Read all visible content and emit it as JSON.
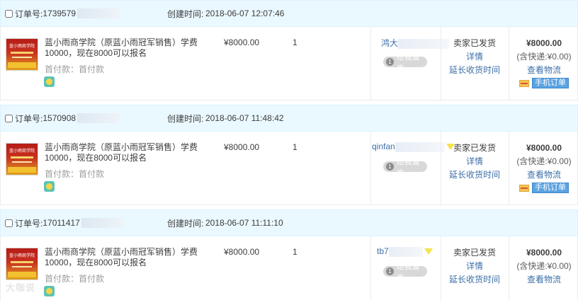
{
  "labels": {
    "order_no": "订单号:",
    "created_at": "创建时间:",
    "first_payment": "首付款：首付款",
    "leave_message": "给我留言",
    "message_count": "1",
    "seller_shipped": "卖家已发货",
    "details": "详情",
    "extend_receipt": "延长收货时间",
    "view_logistics": "查看物流",
    "mobile_order": "手机订单",
    "thumb_title": "蓝小雨商学院"
  },
  "orders": [
    {
      "order_no": "1739579",
      "created_at": "2018-06-07 12:07:46",
      "title": "蓝小雨商学院（原蓝小雨冠军销售）学费10000，现在8000可以报名",
      "price": "¥8000.00",
      "qty": "1",
      "buyer": "鸿大",
      "total": "¥8000.00",
      "shipping": "(含快递:¥0.00)"
    },
    {
      "order_no": "1570908",
      "created_at": "2018-06-07 11:48:42",
      "title": "蓝小雨商学院（原蓝小雨冠军销售）学费10000，现在8000可以报名",
      "price": "¥8000.00",
      "qty": "1",
      "buyer": "qinfan",
      "total": "¥8000.00",
      "shipping": "(含快递:¥0.00)"
    },
    {
      "order_no": "17011417",
      "created_at": "2018-06-07 11:11:10",
      "title": "蓝小雨商学院（原蓝小雨冠军销售）学费10000，现在8000可以报名",
      "price": "¥8000.00",
      "qty": "1",
      "buyer": "tb7",
      "total": "¥8000.00",
      "shipping": "(含快递:¥0.00)"
    }
  ],
  "watermark": "大咖说"
}
